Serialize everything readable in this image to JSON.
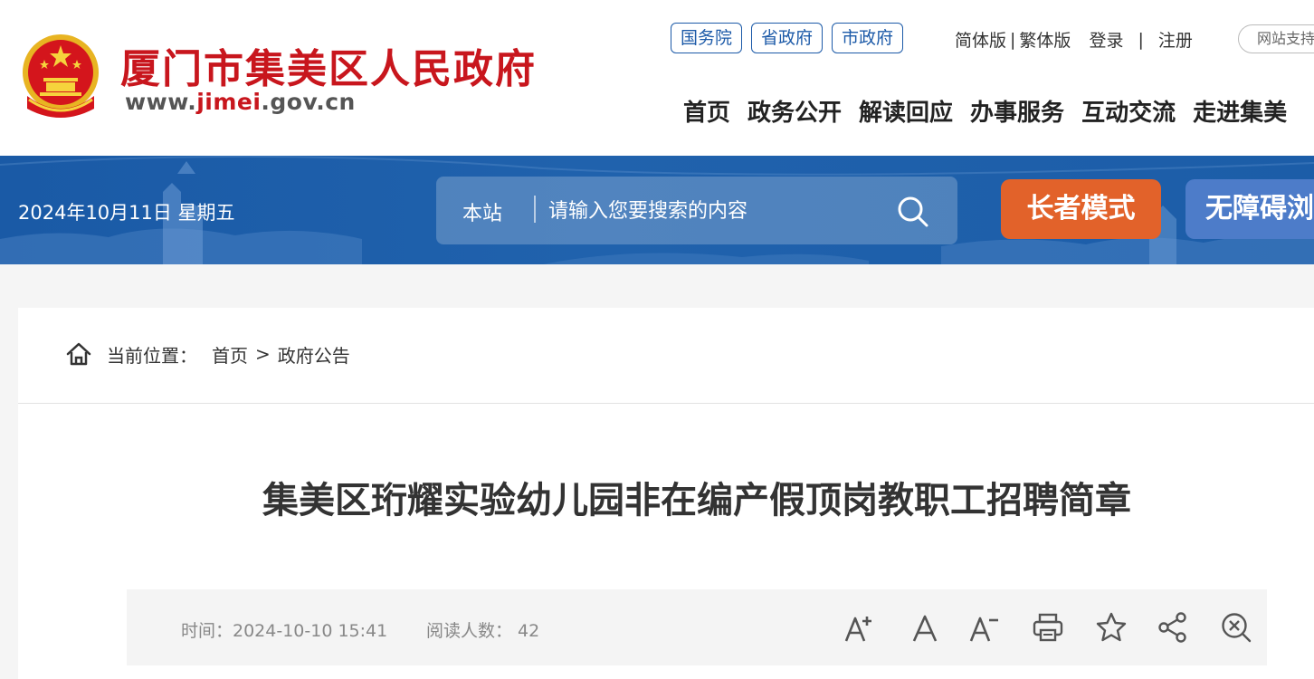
{
  "header": {
    "site_title": "厦门市集美区人民政府",
    "site_url_prefix": "www.",
    "site_url_highlight": "jimei",
    "site_url_suffix": ".gov.cn",
    "gov_links": [
      "国务院",
      "省政府",
      "市政府"
    ],
    "lang_simplified": "简体版",
    "lang_separator": "|",
    "lang_traditional": "繁体版",
    "login": "登录",
    "util_separator": "|",
    "register": "注册",
    "support": "网站支持",
    "nav": [
      "首页",
      "政务公开",
      "解读回应",
      "办事服务",
      "互动交流",
      "走进集美"
    ]
  },
  "banner": {
    "date": "2024年10月11日 星期五",
    "search_scope": "本站",
    "search_placeholder": "请输入您要搜索的内容",
    "elder_mode": "长者模式",
    "accessibility_mode": "无障碍浏览"
  },
  "breadcrumb": {
    "label": "当前位置：",
    "home": "首页",
    "separator": ">",
    "current": "政府公告"
  },
  "article": {
    "title": "集美区珩耀实验幼儿园非在编产假顶岗教职工招聘简章",
    "time": "时间：2024-10-10 15:41",
    "reads": "阅读人数： 42"
  },
  "colors": {
    "brand_red": "#c8161d",
    "banner_blue": "#1c5da8",
    "elder_orange": "#e2622a",
    "access_blue": "#4d7cc9"
  }
}
